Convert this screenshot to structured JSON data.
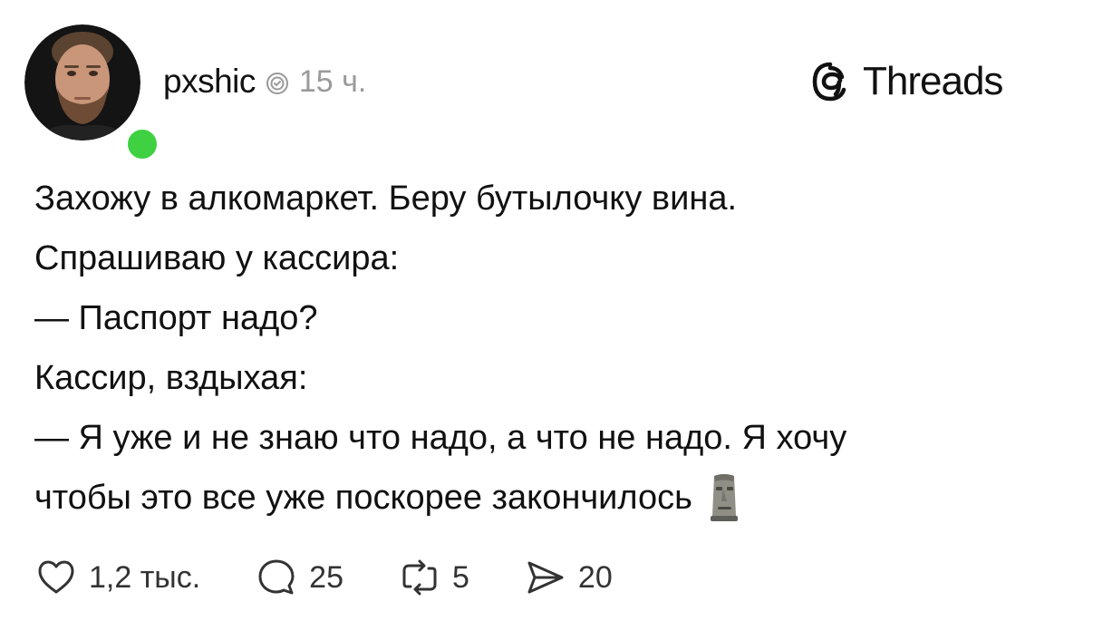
{
  "post": {
    "author": {
      "username": "pxshic",
      "time": "15 ч.",
      "online": true
    },
    "brand": {
      "name": "Threads",
      "icon": "threads-logo-icon"
    },
    "lines": [
      "Захожу в алкомаркет. Беру бутылочку вина.",
      "Спрашиваю у кассира:",
      "— Паспорт надо?",
      "Кассир, вздыхая:",
      "— Я уже и не знаю что надо, а что не надо. Я хочу",
      "чтобы это все уже поскорее закончилось"
    ],
    "emoji": "moai-icon",
    "actions": {
      "likes": "1,2 тыс.",
      "replies": "25",
      "reposts": "5",
      "shares": "20"
    }
  },
  "colors": {
    "online_dot": "#3fd142",
    "muted_text": "#9a9a9a",
    "text": "#111111"
  }
}
